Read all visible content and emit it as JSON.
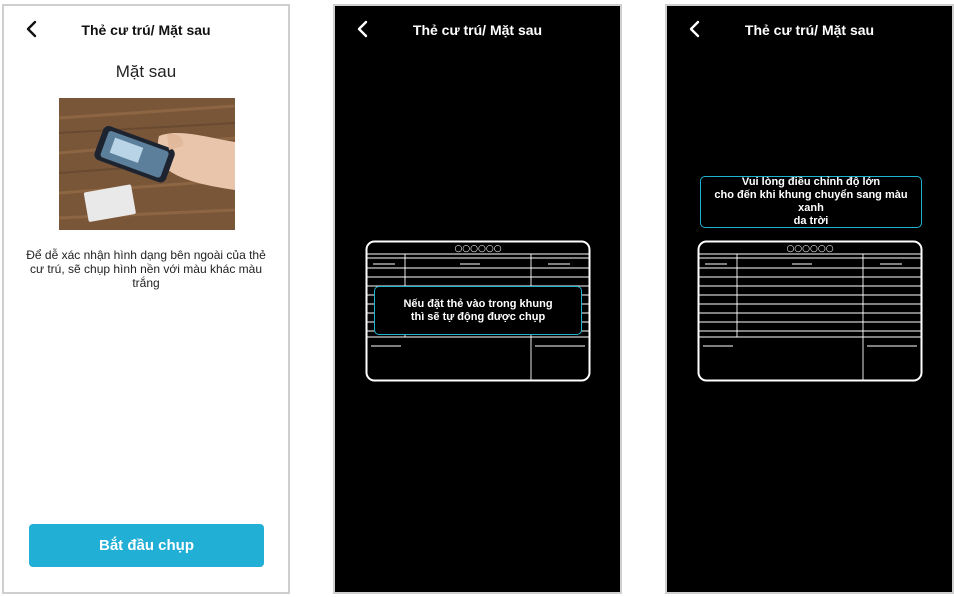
{
  "screens": [
    {
      "header": {
        "title": "Thẻ cư trú/ Mặt sau",
        "back_icon": "chevron-left-icon"
      },
      "subtitle": "Mặt sau",
      "description": "Để dễ xác nhận hình dạng bên ngoài của thẻ cư trú, sẽ chụp hình nền với màu khác màu trắng",
      "start_button_label": "Bắt đầu chụp"
    },
    {
      "header": {
        "title": "Thẻ cư trú/ Mặt sau",
        "back_icon": "chevron-left-icon"
      },
      "card_code": "○○○○○○",
      "message_lines": [
        "Nếu đặt thẻ vào trong khung",
        "thì sẽ tự động được chụp"
      ]
    },
    {
      "header": {
        "title": "Thẻ cư trú/ Mặt sau",
        "back_icon": "chevron-left-icon"
      },
      "card_code": "○○○○○○",
      "message_lines": [
        "Vui lòng điều chỉnh độ lớn",
        "cho đến khi khung chuyển sang màu xanh",
        "da trời"
      ]
    }
  ],
  "colors": {
    "accent": "#22afd6",
    "frame_border": "#1fb3d2",
    "camera_bg": "#000000"
  }
}
